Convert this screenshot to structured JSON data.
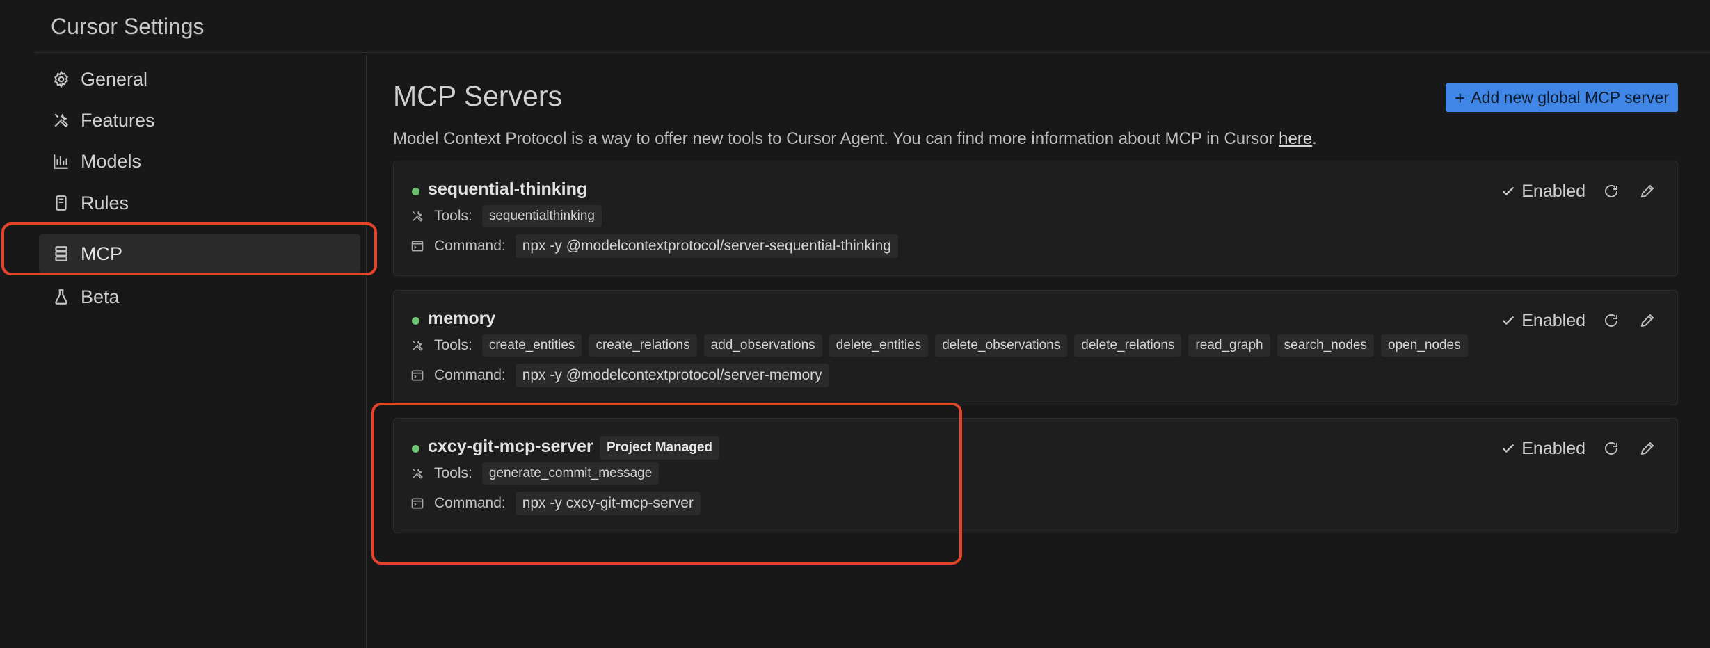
{
  "window": {
    "title": "Cursor Settings"
  },
  "sidebar": {
    "items": [
      {
        "label": "General",
        "icon": "gear-icon",
        "active": false
      },
      {
        "label": "Features",
        "icon": "tools-icon",
        "active": false
      },
      {
        "label": "Models",
        "icon": "bar-chart-icon",
        "active": false
      },
      {
        "label": "Rules",
        "icon": "document-icon",
        "active": false
      },
      {
        "label": "MCP",
        "icon": "server-icon",
        "active": true
      },
      {
        "label": "Beta",
        "icon": "flask-icon",
        "active": false
      }
    ]
  },
  "main": {
    "title": "MCP Servers",
    "add_button_label": "Add new global MCP server",
    "description_text": "Model Context Protocol is a way to offer new tools to Cursor Agent. You can find more information about MCP in Cursor ",
    "description_link": "here",
    "description_end": ".",
    "tools_label": "Tools:",
    "command_label": "Command:",
    "enabled_label": "Enabled",
    "servers": [
      {
        "name": "sequential-thinking",
        "status_color": "#6cc26f",
        "badge": "",
        "tools": [
          "sequentialthinking"
        ],
        "command": "npx -y @modelcontextprotocol/server-sequential-thinking"
      },
      {
        "name": "memory",
        "status_color": "#6cc26f",
        "badge": "",
        "tools": [
          "create_entities",
          "create_relations",
          "add_observations",
          "delete_entities",
          "delete_observations",
          "delete_relations",
          "read_graph",
          "search_nodes",
          "open_nodes"
        ],
        "command": "npx -y @modelcontextprotocol/server-memory"
      },
      {
        "name": "cxcy-git-mcp-server",
        "status_color": "#6cc26f",
        "badge": "Project Managed",
        "tools": [
          "generate_commit_message"
        ],
        "command": "npx -y cxcy-git-mcp-server"
      }
    ]
  },
  "colors": {
    "accent": "#3f86e6",
    "highlight": "#e5432c",
    "status_ok": "#6cc26f",
    "background": "#181818"
  }
}
